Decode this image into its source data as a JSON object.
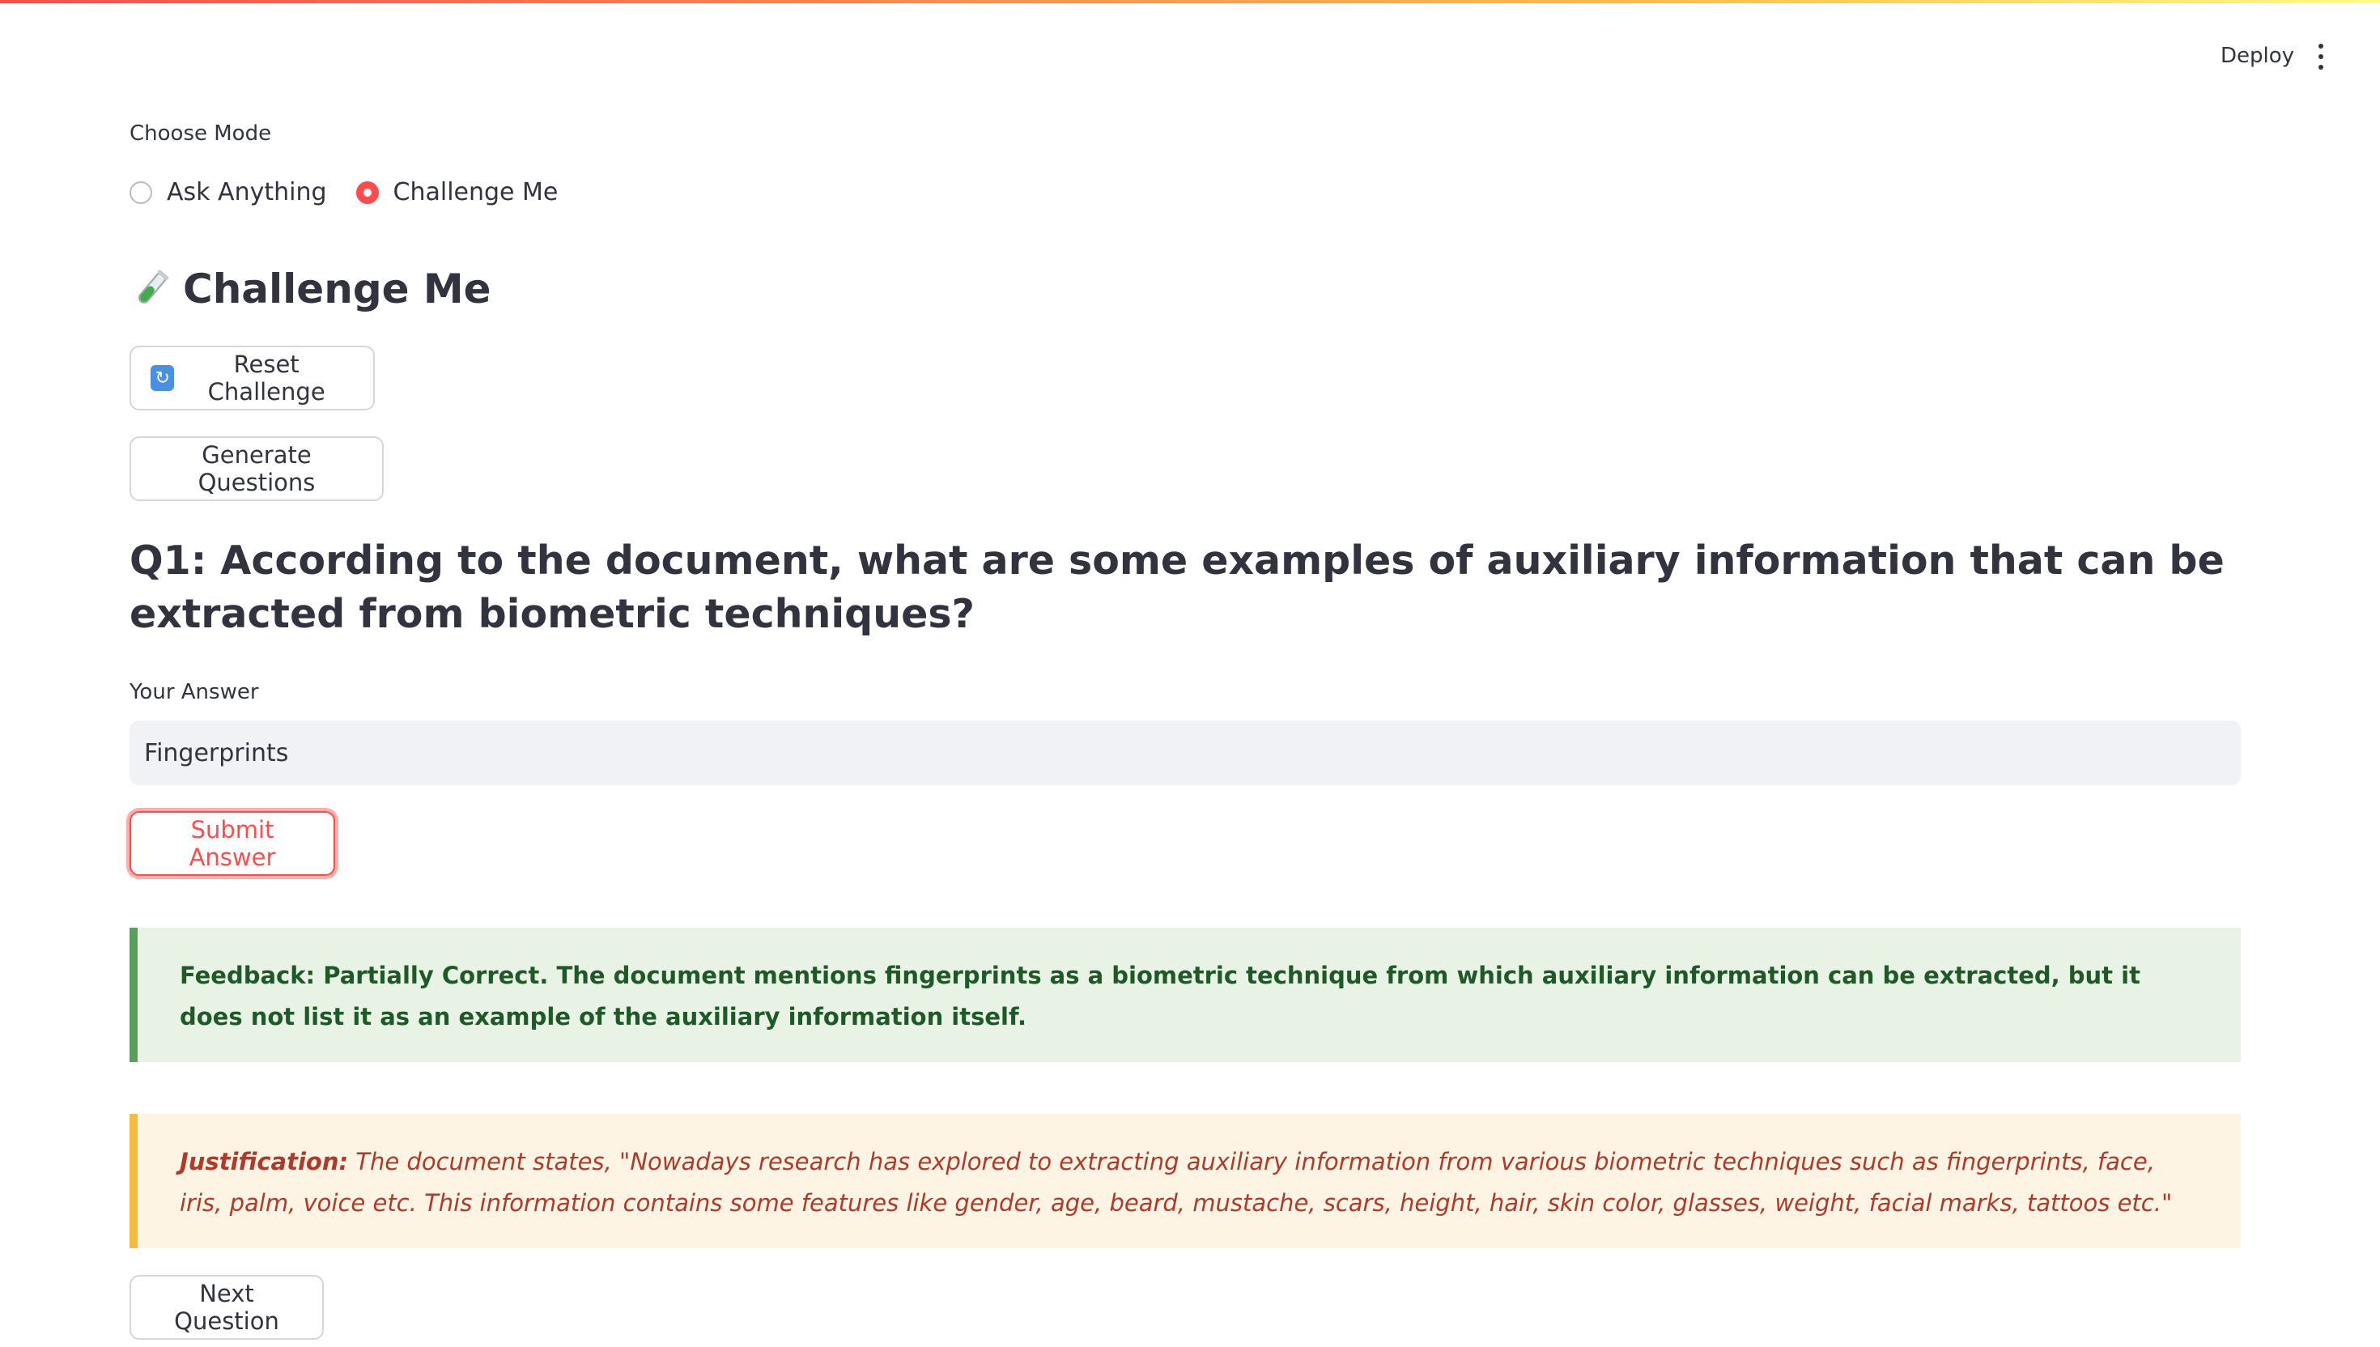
{
  "header": {
    "deploy_label": "Deploy",
    "menu_icon": "kebab-menu-icon",
    "accent_gradient": [
      "#ff4b4b",
      "#ffbd45",
      "#fffd80"
    ]
  },
  "mode": {
    "label": "Choose Mode",
    "options": [
      {
        "label": "Ask Anything",
        "selected": false
      },
      {
        "label": "Challenge Me",
        "selected": true
      }
    ]
  },
  "page": {
    "title": "Challenge Me",
    "title_icon": "test-tube-icon"
  },
  "buttons": {
    "reset_label": "Reset Challenge",
    "reset_icon": "repeat-icon",
    "generate_label": "Generate Questions",
    "submit_label": "Submit Answer",
    "next_label": "Next Question"
  },
  "question": {
    "text": "Q1: According to the document, what are some examples of auxiliary information that can be extracted from biometric techniques?"
  },
  "answer": {
    "label": "Your Answer",
    "value": "Fingerprints"
  },
  "feedback": {
    "text": "Feedback: Partially Correct. The document mentions fingerprints as a biometric technique from which auxiliary information can be extracted, but it does not list it as an example of the auxiliary information itself."
  },
  "justification": {
    "heading": "Justification:",
    "text": "The document states, \"Nowadays research has explored to extracting auxiliary information from various biometric techniques such as fingerprints, face, iris, palm, voice etc. This information contains some features like gender, age, beard, mustache, scars, height, hair, skin color, glasses, weight, facial marks, tattoos etc.\""
  },
  "colors": {
    "primary": "#ff4b4b",
    "success_bg": "#e8f3e6",
    "success_text": "#1e5a27",
    "warning_bg": "#fdf4e3",
    "warning_text": "#b0392a",
    "input_bg": "#f0f2f6"
  }
}
